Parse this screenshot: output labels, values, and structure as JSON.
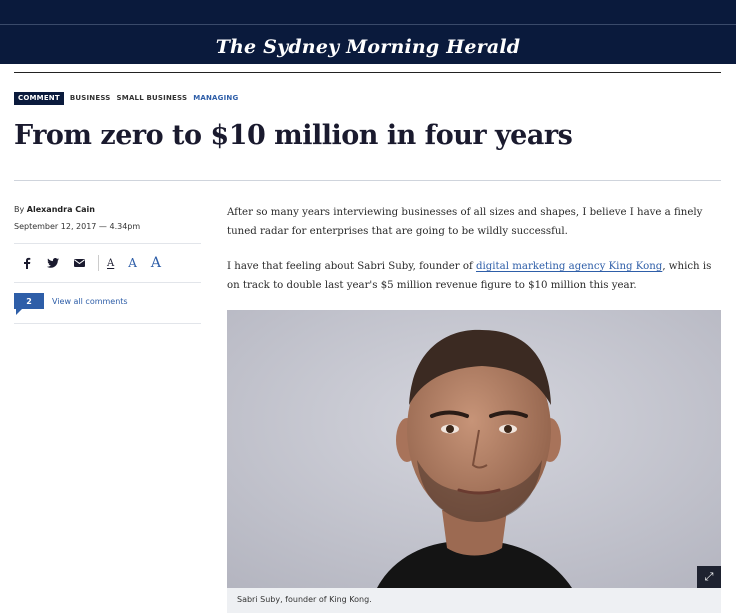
{
  "masthead": {
    "logo": "The Sydney Morning Herald"
  },
  "tags": {
    "comment": "COMMENT",
    "items": [
      "BUSINESS",
      "SMALL BUSINESS",
      "MANAGING"
    ]
  },
  "article": {
    "headline": "From zero to $10 million in four years",
    "byline_prefix": "By",
    "author": "Alexandra Cain",
    "date": "September 12, 2017 — 4.34pm",
    "paragraph1": "After so many years interviewing businesses of all sizes and shapes, I believe I have a finely tuned radar for enterprises that are going to be wildly successful.",
    "paragraph2_before": "I have that feeling about Sabri Suby, founder of ",
    "paragraph2_link": "digital marketing agency King Kong",
    "paragraph2_after": ", which is on track to double last year's $5 million revenue figure to $10 million this year.",
    "caption": "Sabri Suby, founder of King Kong."
  },
  "share": {
    "icons": [
      "facebook-icon",
      "twitter-icon",
      "email-icon"
    ],
    "font_labels": [
      "A",
      "A",
      "A"
    ]
  },
  "comments": {
    "count": "2",
    "link": "View all comments"
  },
  "colors": {
    "navy": "#0a1a3c",
    "link": "#2e5ea8",
    "photo_bg": "#c9cad3"
  }
}
